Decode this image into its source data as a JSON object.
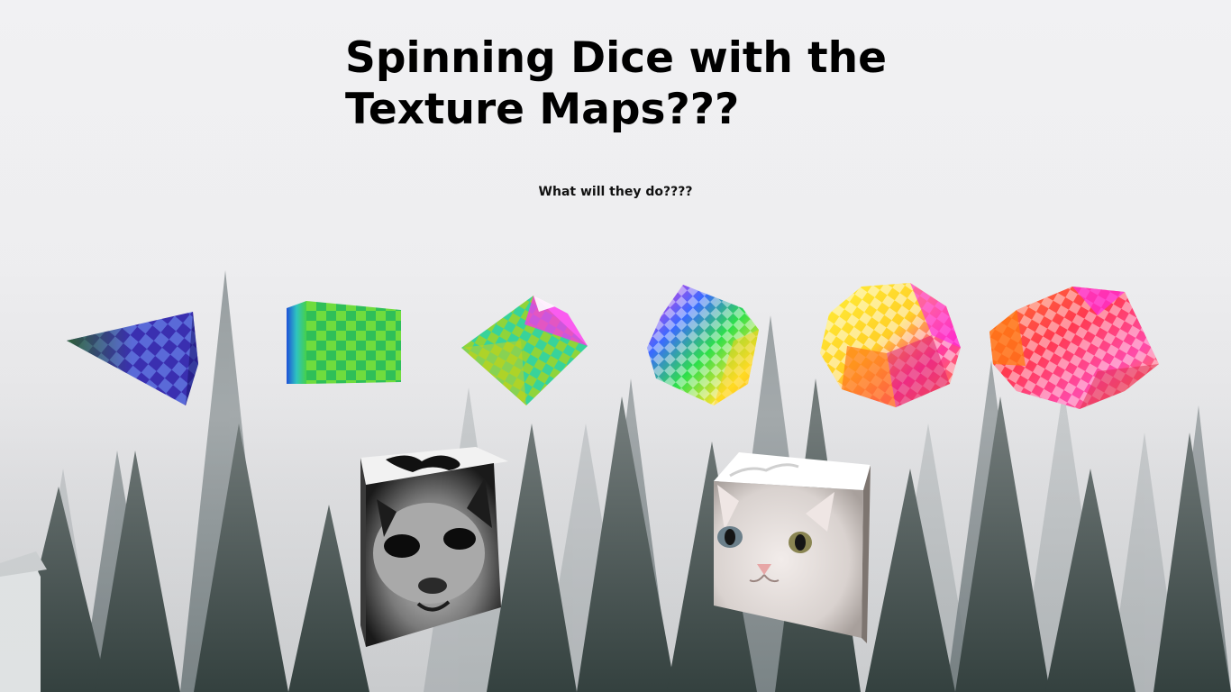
{
  "page": {
    "title": "Spinning Dice with the Texture Maps???",
    "subtitle": "What will they do????"
  },
  "background": {
    "scene": "misty pine forest",
    "colors": {
      "sky": "#eeeef0",
      "tree_far": "#8c9496",
      "tree_mid": "#5d6a6c",
      "tree_near": "#2f3b3a"
    }
  },
  "dice": [
    {
      "name": "d4-tetrahedron",
      "texture": "blue-purple checker"
    },
    {
      "name": "d6-cube-green",
      "texture": "green checker"
    },
    {
      "name": "d8-octahedron",
      "texture": "yellow-green checker"
    },
    {
      "name": "d10-decahedron",
      "texture": "rainbow checker"
    },
    {
      "name": "d12-dodecahedron",
      "texture": "yellow-pink checker"
    },
    {
      "name": "d20-icosahedron",
      "texture": "orange-red checker"
    },
    {
      "name": "cube-cat-grey",
      "texture": "black and white cat photo"
    },
    {
      "name": "cube-cat-white",
      "texture": "white cat photo"
    }
  ]
}
